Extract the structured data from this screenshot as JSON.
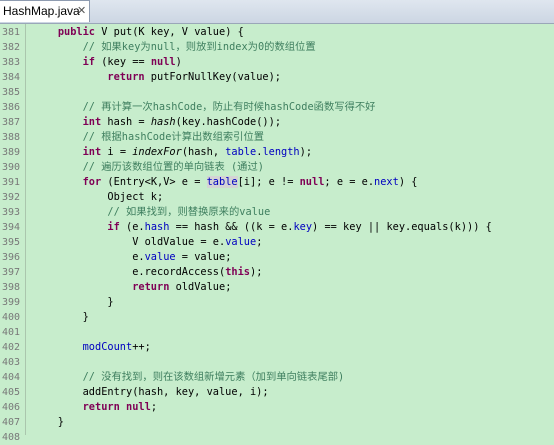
{
  "tab": {
    "title": "HashMap.java",
    "close_glyph": "✕"
  },
  "colors": {
    "editor_bg": "#c7edcc",
    "keyword": "#7f0055",
    "comment": "#3f7f5f",
    "field": "#0000c0",
    "line_number": "#787878"
  },
  "lines": [
    {
      "n": "381",
      "segs": [
        [
          "p",
          "    "
        ],
        [
          "kw",
          "public"
        ],
        [
          "p",
          " V put(K key, V value) {"
        ]
      ]
    },
    {
      "n": "382",
      "segs": [
        [
          "p",
          "        "
        ],
        [
          "cm",
          "// 如果key为null，则放到index为0的数组位置"
        ]
      ]
    },
    {
      "n": "383",
      "segs": [
        [
          "p",
          "        "
        ],
        [
          "kw",
          "if"
        ],
        [
          "p",
          " (key == "
        ],
        [
          "kw",
          "null"
        ],
        [
          "p",
          ")"
        ]
      ]
    },
    {
      "n": "384",
      "segs": [
        [
          "p",
          "            "
        ],
        [
          "kw",
          "return"
        ],
        [
          "p",
          " putForNullKey(value);"
        ]
      ]
    },
    {
      "n": "385",
      "segs": []
    },
    {
      "n": "386",
      "segs": [
        [
          "p",
          "        "
        ],
        [
          "cm",
          "// 再计算一次hashCode，防止有时候hashCode函数写得不好"
        ]
      ]
    },
    {
      "n": "387",
      "segs": [
        [
          "p",
          "        "
        ],
        [
          "kw",
          "int"
        ],
        [
          "p",
          " hash = "
        ],
        [
          "it",
          "hash"
        ],
        [
          "p",
          "(key.hashCode());"
        ]
      ]
    },
    {
      "n": "388",
      "segs": [
        [
          "p",
          "        "
        ],
        [
          "cm",
          "// 根据hashCode计算出数组索引位置"
        ]
      ]
    },
    {
      "n": "389",
      "segs": [
        [
          "p",
          "        "
        ],
        [
          "kw",
          "int"
        ],
        [
          "p",
          " i = "
        ],
        [
          "it",
          "indexFor"
        ],
        [
          "p",
          "(hash, "
        ],
        [
          "fd",
          "table"
        ],
        [
          "p",
          "."
        ],
        [
          "fd",
          "length"
        ],
        [
          "p",
          ");"
        ]
      ]
    },
    {
      "n": "390",
      "segs": [
        [
          "p",
          "        "
        ],
        [
          "cm",
          "// 遍历该数组位置的单向链表 (通过)"
        ]
      ]
    },
    {
      "n": "391",
      "segs": [
        [
          "p",
          "        "
        ],
        [
          "kw",
          "for"
        ],
        [
          "p",
          " (Entry<K,V> e = "
        ],
        [
          "hl",
          "table"
        ],
        [
          "p",
          "[i]; e != "
        ],
        [
          "kw",
          "null"
        ],
        [
          "p",
          "; e = e."
        ],
        [
          "fd",
          "next"
        ],
        [
          "p",
          ") {"
        ]
      ]
    },
    {
      "n": "392",
      "segs": [
        [
          "p",
          "            Object k;"
        ]
      ]
    },
    {
      "n": "393",
      "segs": [
        [
          "p",
          "            "
        ],
        [
          "cm",
          "// 如果找到，则替换原来的value"
        ]
      ]
    },
    {
      "n": "394",
      "segs": [
        [
          "p",
          "            "
        ],
        [
          "kw",
          "if"
        ],
        [
          "p",
          " (e."
        ],
        [
          "fd",
          "hash"
        ],
        [
          "p",
          " == hash && ((k = e."
        ],
        [
          "fd",
          "key"
        ],
        [
          "p",
          ") == key || key.equals(k))) {"
        ]
      ]
    },
    {
      "n": "395",
      "segs": [
        [
          "p",
          "                V oldValue = e."
        ],
        [
          "fd",
          "value"
        ],
        [
          "p",
          ";"
        ]
      ]
    },
    {
      "n": "396",
      "segs": [
        [
          "p",
          "                e."
        ],
        [
          "fd",
          "value"
        ],
        [
          "p",
          " = value;"
        ]
      ]
    },
    {
      "n": "397",
      "segs": [
        [
          "p",
          "                e.recordAccess("
        ],
        [
          "kw",
          "this"
        ],
        [
          "p",
          ");"
        ]
      ]
    },
    {
      "n": "398",
      "segs": [
        [
          "p",
          "                "
        ],
        [
          "kw",
          "return"
        ],
        [
          "p",
          " oldValue;"
        ]
      ]
    },
    {
      "n": "399",
      "segs": [
        [
          "p",
          "            }"
        ]
      ]
    },
    {
      "n": "400",
      "segs": [
        [
          "p",
          "        }"
        ]
      ]
    },
    {
      "n": "401",
      "segs": []
    },
    {
      "n": "402",
      "segs": [
        [
          "p",
          "        "
        ],
        [
          "fd",
          "modCount"
        ],
        [
          "p",
          "++;"
        ]
      ]
    },
    {
      "n": "403",
      "segs": []
    },
    {
      "n": "404",
      "segs": [
        [
          "p",
          "        "
        ],
        [
          "cm",
          "// 没有找到，则在该数组新增元素（加到单向链表尾部)"
        ]
      ]
    },
    {
      "n": "405",
      "segs": [
        [
          "p",
          "        addEntry(hash, key, value, i);"
        ]
      ]
    },
    {
      "n": "406",
      "segs": [
        [
          "p",
          "        "
        ],
        [
          "kw",
          "return"
        ],
        [
          "p",
          " "
        ],
        [
          "kw",
          "null"
        ],
        [
          "p",
          ";"
        ]
      ]
    },
    {
      "n": "407",
      "segs": [
        [
          "p",
          "    }"
        ]
      ]
    },
    {
      "n": "408",
      "segs": []
    }
  ]
}
